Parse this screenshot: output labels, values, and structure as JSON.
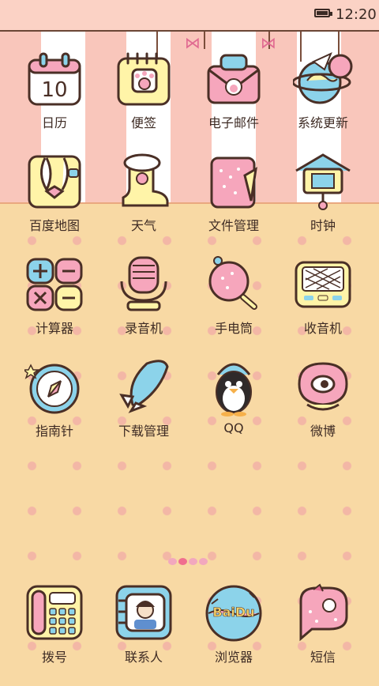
{
  "status_bar": {
    "time": "12:20",
    "battery_icon": "battery-icon"
  },
  "apps": [
    {
      "label": "日历",
      "icon": "calendar-icon",
      "badge_text": "10"
    },
    {
      "label": "便签",
      "icon": "notes-icon"
    },
    {
      "label": "电子邮件",
      "icon": "mail-icon"
    },
    {
      "label": "系统更新",
      "icon": "globe-update-icon"
    },
    {
      "label": "百度地图",
      "icon": "map-icon"
    },
    {
      "label": "天气",
      "icon": "weather-boot-icon"
    },
    {
      "label": "文件管理",
      "icon": "folder-icon"
    },
    {
      "label": "时钟",
      "icon": "clock-house-icon"
    },
    {
      "label": "计算器",
      "icon": "calculator-icon"
    },
    {
      "label": "录音机",
      "icon": "microphone-icon"
    },
    {
      "label": "手电筒",
      "icon": "flashlight-icon"
    },
    {
      "label": "收音机",
      "icon": "radio-icon"
    },
    {
      "label": "指南针",
      "icon": "compass-icon"
    },
    {
      "label": "下载管理",
      "icon": "download-rocket-icon"
    },
    {
      "label": "QQ",
      "icon": "qq-penguin-icon"
    },
    {
      "label": "微博",
      "icon": "weibo-icon"
    }
  ],
  "dock": [
    {
      "label": "拨号",
      "icon": "phone-icon"
    },
    {
      "label": "联系人",
      "icon": "contacts-icon"
    },
    {
      "label": "浏览器",
      "icon": "browser-icon",
      "badge_text": "BaiDu"
    },
    {
      "label": "短信",
      "icon": "message-mitten-icon"
    }
  ],
  "pager": {
    "pages": 4,
    "active": 1
  },
  "colors": {
    "stripe_pink": "#f9c6bb",
    "background": "#f8d9a4",
    "text": "#3e2b24",
    "accent": "#f06f8f"
  }
}
